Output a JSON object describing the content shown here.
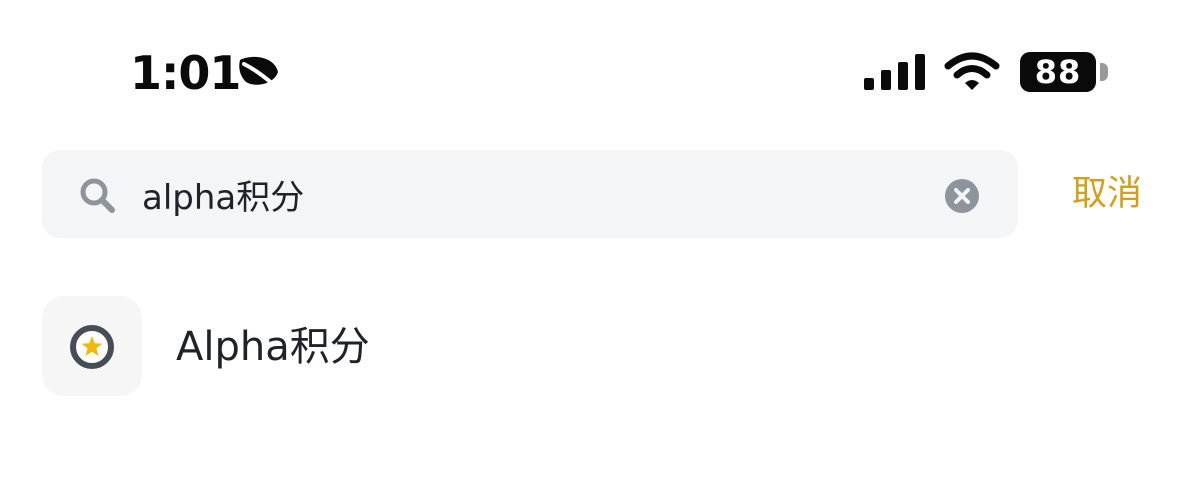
{
  "status_bar": {
    "time": "1:01",
    "battery_level": "88",
    "icons": [
      "focus-leaf-icon",
      "cellular-signal-icon",
      "wifi-icon",
      "battery-icon"
    ]
  },
  "search": {
    "query": "alpha积分",
    "cancel_label": "取消",
    "icons": [
      "search-icon",
      "clear-icon"
    ]
  },
  "results": [
    {
      "label": "Alpha积分",
      "icon": "alpha-points-icon"
    }
  ],
  "colors": {
    "accent": "#d4a017",
    "star": "#f0b90b",
    "icon_dark": "#474d57",
    "search_bg": "#f4f5f6",
    "text": "#1f2329"
  }
}
